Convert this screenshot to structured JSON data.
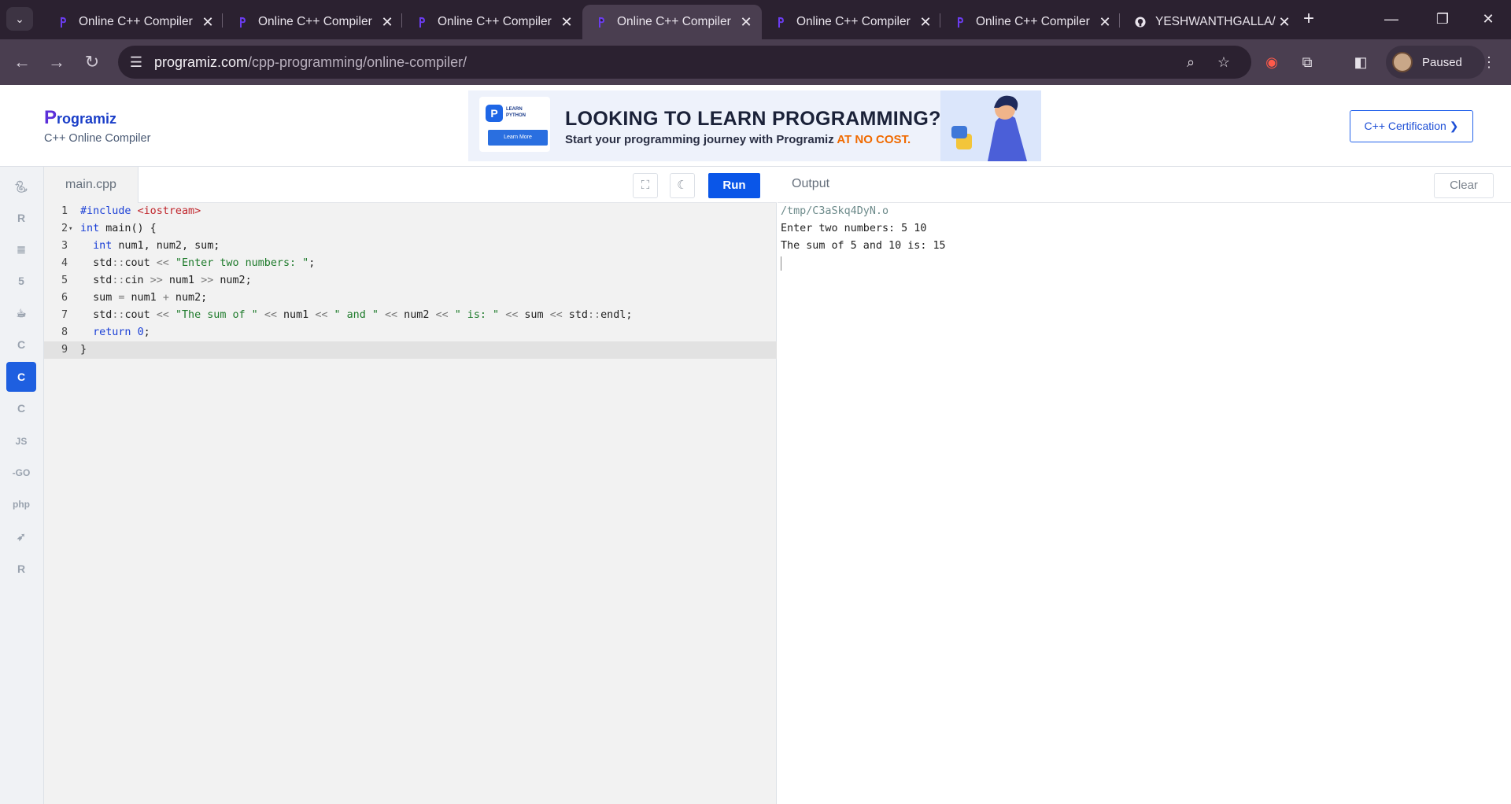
{
  "browser": {
    "tabs": [
      {
        "title": "Online C++ Compiler",
        "active": false
      },
      {
        "title": "Online C++ Compiler",
        "active": false
      },
      {
        "title": "Online C++ Compiler",
        "active": false
      },
      {
        "title": "Online C++ Compiler",
        "active": true
      },
      {
        "title": "Online C++ Compiler",
        "active": false
      },
      {
        "title": "Online C++ Compiler",
        "active": false
      },
      {
        "title": "YESHWANTHGALLA/",
        "active": false
      }
    ],
    "url_host": "programiz.com",
    "url_path": "/cpp-programming/online-compiler/",
    "profile_label": "Paused"
  },
  "header": {
    "logo_first": "P",
    "logo_rest": "rogramiz",
    "subtitle": "C++ Online Compiler",
    "banner": {
      "card_logo": "P",
      "card_text_1": "LEARN",
      "card_text_2": "PYTHON",
      "card_button": "Learn More",
      "headline": "LOOKING TO LEARN PROGRAMMING?",
      "subline": "Start your programming journey with Programiz ",
      "highlight": "AT NO COST."
    },
    "cert_button": "C++ Certification ❯"
  },
  "languages": [
    {
      "name": "python",
      "glyph": "🐍︎"
    },
    {
      "name": "r",
      "glyph": "R"
    },
    {
      "name": "sql",
      "glyph": "≣"
    },
    {
      "name": "html",
      "glyph": "5"
    },
    {
      "name": "java",
      "glyph": "☕︎"
    },
    {
      "name": "c",
      "glyph": "C"
    },
    {
      "name": "cpp",
      "glyph": "C"
    },
    {
      "name": "csharp",
      "glyph": "C"
    },
    {
      "name": "js",
      "glyph": "JS"
    },
    {
      "name": "go",
      "glyph": "-GO"
    },
    {
      "name": "php",
      "glyph": "php"
    },
    {
      "name": "swift",
      "glyph": "➶"
    },
    {
      "name": "rust",
      "glyph": "R"
    }
  ],
  "editor": {
    "filename": "main.cpp",
    "run_label": "Run",
    "lines": [
      "#include <iostream>",
      "int main() {",
      "  int num1, num2, sum;",
      "  std::cout << \"Enter two numbers: \";",
      "  std::cin >> num1 >> num2;",
      "  sum = num1 + num2;",
      "  std::cout << \"The sum of \" << num1 << \" and \" << num2 << \" is: \" << sum << std::endl;",
      "  return 0;",
      "}"
    ]
  },
  "output": {
    "title": "Output",
    "clear_label": "Clear",
    "lines": [
      "/tmp/C3aSkq4DyN.o",
      "Enter two numbers: 5 10",
      "The sum of 5 and 10 is: 15"
    ]
  }
}
